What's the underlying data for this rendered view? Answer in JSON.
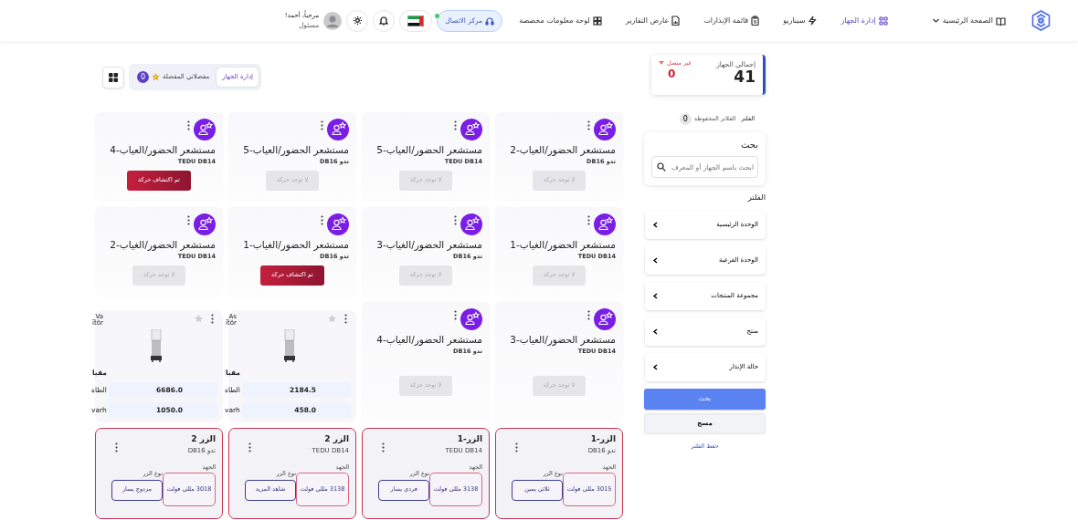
{
  "navbar": {
    "items": [
      {
        "label": "الصفحة الرئيسية",
        "dropdown": true,
        "selected": false
      },
      {
        "label": "إدارة الجهاز",
        "dropdown": false,
        "selected": true
      },
      {
        "label": "سيناريو",
        "dropdown": false,
        "selected": false
      },
      {
        "label": "قائمة الإنذارات",
        "dropdown": false,
        "selected": false
      },
      {
        "label": "عارض التقارير",
        "dropdown": false,
        "selected": false
      },
      {
        "label": "لوحة معلومات مخصصة",
        "dropdown": false,
        "selected": false
      }
    ],
    "contact_center": {
      "label": "مركز الاتصال",
      "online": true
    },
    "user": {
      "greeting": "مرحباً، أحمد!",
      "role": "مسئول"
    }
  },
  "toolbar": {
    "tabs": [
      {
        "label": "إدارة الجهاز",
        "selected": true
      },
      {
        "label": "مفضلاتي المفضلة",
        "selected": false,
        "badge": "0"
      }
    ]
  },
  "devices": [
    {
      "kind": "sensor",
      "title": "مستشعر الحضور/العياب-2",
      "model": "تدو DB16",
      "status": "لا توجد حركة",
      "motion": false
    },
    {
      "kind": "sensor",
      "title": "مستشعر الحضور/العياب-5",
      "model": "TEDU DB14",
      "status": "لا توجد حركة",
      "motion": false
    },
    {
      "kind": "sensor",
      "title": "مستشعر الحضور/العياب-5",
      "model": "تدو DB16",
      "status": "لا توجد حركة",
      "motion": false
    },
    {
      "kind": "sensor",
      "title": "مستشعر الحضور/العياب-4",
      "model": "TEDU DB14",
      "status": "تم اكتشاف حركة",
      "motion": true
    },
    {
      "kind": "sensor",
      "title": "مستشعر الحضور/الغياب-1",
      "model": "TEDU DB14",
      "status": "لا توجد حركة",
      "motion": false
    },
    {
      "kind": "sensor",
      "title": "مستشعر الحضور/الغياب-3",
      "model": "تدو DB16",
      "status": "لا توجد حركة",
      "motion": false
    },
    {
      "kind": "sensor",
      "title": "مستشعر الحضور/الغياب-1",
      "model": "تدو DB16",
      "status": "تم اكتشاف حركة",
      "motion": true
    },
    {
      "kind": "sensor",
      "title": "مستشعر الحضور/الغياب-2",
      "model": "TEDU DB14",
      "status": "لا توجد حركة",
      "motion": false
    },
    {
      "kind": "sensor",
      "title": "مستشعر الحضور/العياب-3",
      "model": "TEDU DB14",
      "status": "لا توجد حركة",
      "motion": false
    },
    {
      "kind": "sensor",
      "title": "مستشعر الحضور/العياب-4",
      "model": "تدو DB16",
      "status": "لا توجد حركة",
      "motion": false
    },
    {
      "kind": "meter",
      "name_lines": [
        "_As",
        "ıtör"
      ],
      "section": "مقيا",
      "readings": [
        {
          "label": "الطاة",
          "value": "2184.5"
        },
        {
          "label": "varh",
          "value": "458.0"
        }
      ]
    },
    {
      "kind": "meter",
      "name_lines": [
        "_Va",
        "ıtör"
      ],
      "section": "مقيا",
      "readings": [
        {
          "label": "الطاة",
          "value": "6686.0"
        },
        {
          "label": "varh",
          "value": "1050.0"
        }
      ]
    },
    {
      "kind": "button",
      "title": "الزر-1",
      "model": "تدو DB16",
      "voltage_label": "الجهد",
      "voltage": "3015 مللي فولت",
      "type_label": "نوع الزر",
      "type": "ثلاثي يمين"
    },
    {
      "kind": "button",
      "title": "الزر-1",
      "model": "TEDU DB14",
      "voltage_label": "الجهد",
      "voltage": "3138 مللي فولت",
      "type_label": "نوع الزر",
      "type": "فردي يسار"
    },
    {
      "kind": "button",
      "title": "الزر 2",
      "model": "TEDU DB14",
      "voltage_label": "الجهد",
      "voltage": "3138 مللي فولت",
      "type_label": "نوع الزر",
      "type": "شاهد المزيد"
    },
    {
      "kind": "button",
      "title": "الزر 2",
      "model": "تدو DB16",
      "voltage_label": "الجهد",
      "voltage": "3018 مللي فولت",
      "type_label": "نوع الزر",
      "type": "مزدوج يسار"
    }
  ],
  "summary": {
    "total_label": "إجمالي الجهاز",
    "total": "41",
    "offline_label": "غير متصل",
    "offline": "0"
  },
  "filters": {
    "title": "الفلتر",
    "saved_label": "الفلاتر المحفوظة",
    "saved_count": "0",
    "search_title": "بحث",
    "search_placeholder": "ابحث باسم الجهاز أو المعرف",
    "filter_title": "الفلتر",
    "groups": [
      {
        "label": "الوحدة الرئيسية",
        "expanded": false
      },
      {
        "label": "الوحدة الفرعية",
        "expanded": false
      },
      {
        "label": "مجموعة المنتجات",
        "expanded": false
      },
      {
        "label": "منتج",
        "expanded": false
      },
      {
        "label": "حالة الإنذار",
        "expanded": false
      }
    ],
    "search_button": "بحث",
    "clear_button": "مسح",
    "save_link": "حفظ الفلتر"
  }
}
